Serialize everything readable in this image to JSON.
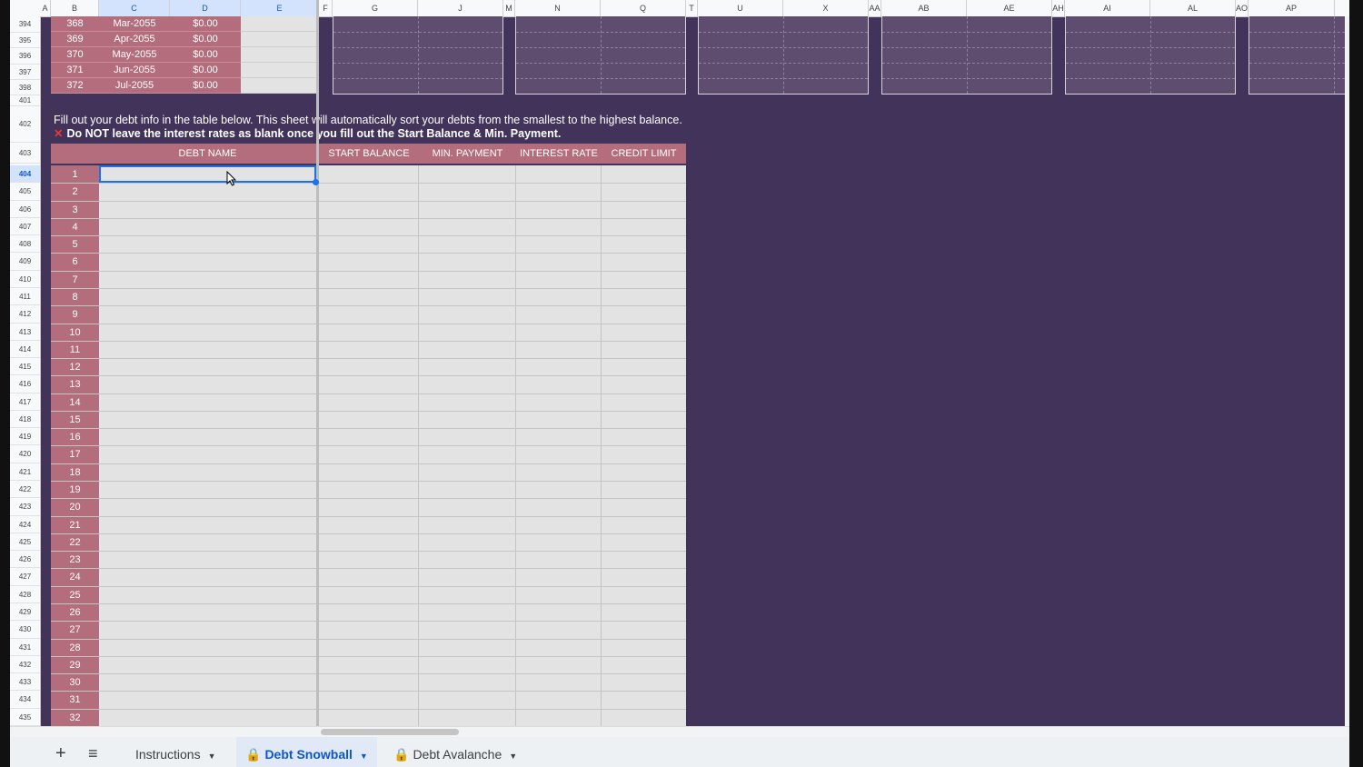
{
  "columns": [
    "A",
    "B",
    "C",
    "D",
    "E",
    "F",
    "G",
    "J",
    "M",
    "N",
    "Q",
    "T",
    "U",
    "X",
    "AA",
    "AB",
    "AE",
    "AH",
    "AI",
    "AL",
    "AO",
    "AP"
  ],
  "top_rows": [
    {
      "row": "394",
      "n": "368",
      "month": "Mar-2055",
      "amount": "$0.00"
    },
    {
      "row": "395",
      "n": "369",
      "month": "Apr-2055",
      "amount": "$0.00"
    },
    {
      "row": "396",
      "n": "370",
      "month": "May-2055",
      "amount": "$0.00"
    },
    {
      "row": "397",
      "n": "371",
      "month": "Jun-2055",
      "amount": "$0.00"
    },
    {
      "row": "398",
      "n": "372",
      "month": "Jul-2055",
      "amount": "$0.00"
    }
  ],
  "row_numbers": [
    "401",
    "402",
    "403",
    "404",
    "405",
    "406",
    "407",
    "408",
    "409",
    "410",
    "411",
    "412",
    "413",
    "414",
    "415",
    "416",
    "417",
    "418",
    "419",
    "420",
    "421",
    "422",
    "423",
    "424",
    "425",
    "426",
    "427",
    "428",
    "429",
    "430",
    "431",
    "432",
    "433",
    "434",
    "435"
  ],
  "selected_row": "404",
  "instructions": {
    "line1": "Fill out your debt info in the table below. This sheet will automatically sort your debts from the smallest to the highest balance.",
    "warning_icon": "cross-mark-icon",
    "line2": "Do NOT leave the interest rates as blank once you fill out the Start Balance & Min. Payment."
  },
  "table": {
    "headers": {
      "debt_name": "DEBT NAME",
      "start_balance": "START BALANCE",
      "min_payment": "MIN. PAYMENT",
      "interest_rate": "INTEREST RATE",
      "credit_limit": "CREDIT LIMIT"
    },
    "row_labels": [
      "1",
      "2",
      "3",
      "4",
      "5",
      "6",
      "7",
      "8",
      "9",
      "10",
      "11",
      "12",
      "13",
      "14",
      "15",
      "16",
      "17",
      "18",
      "19",
      "20",
      "21",
      "22",
      "23",
      "24",
      "25",
      "26",
      "27",
      "28",
      "29",
      "30",
      "31",
      "32"
    ]
  },
  "tabs": {
    "add_icon": "plus-icon",
    "menu_icon": "menu-icon",
    "items": [
      {
        "label": "Instructions",
        "locked": false,
        "active": false
      },
      {
        "label": "Debt Snowball",
        "locked": true,
        "active": true
      },
      {
        "label": "Debt Avalanche",
        "locked": true,
        "active": false
      }
    ]
  },
  "colors": {
    "background": "#42335a",
    "accent": "#b36d7c",
    "cell": "#e3e3e3",
    "selection": "#1a73e8"
  }
}
